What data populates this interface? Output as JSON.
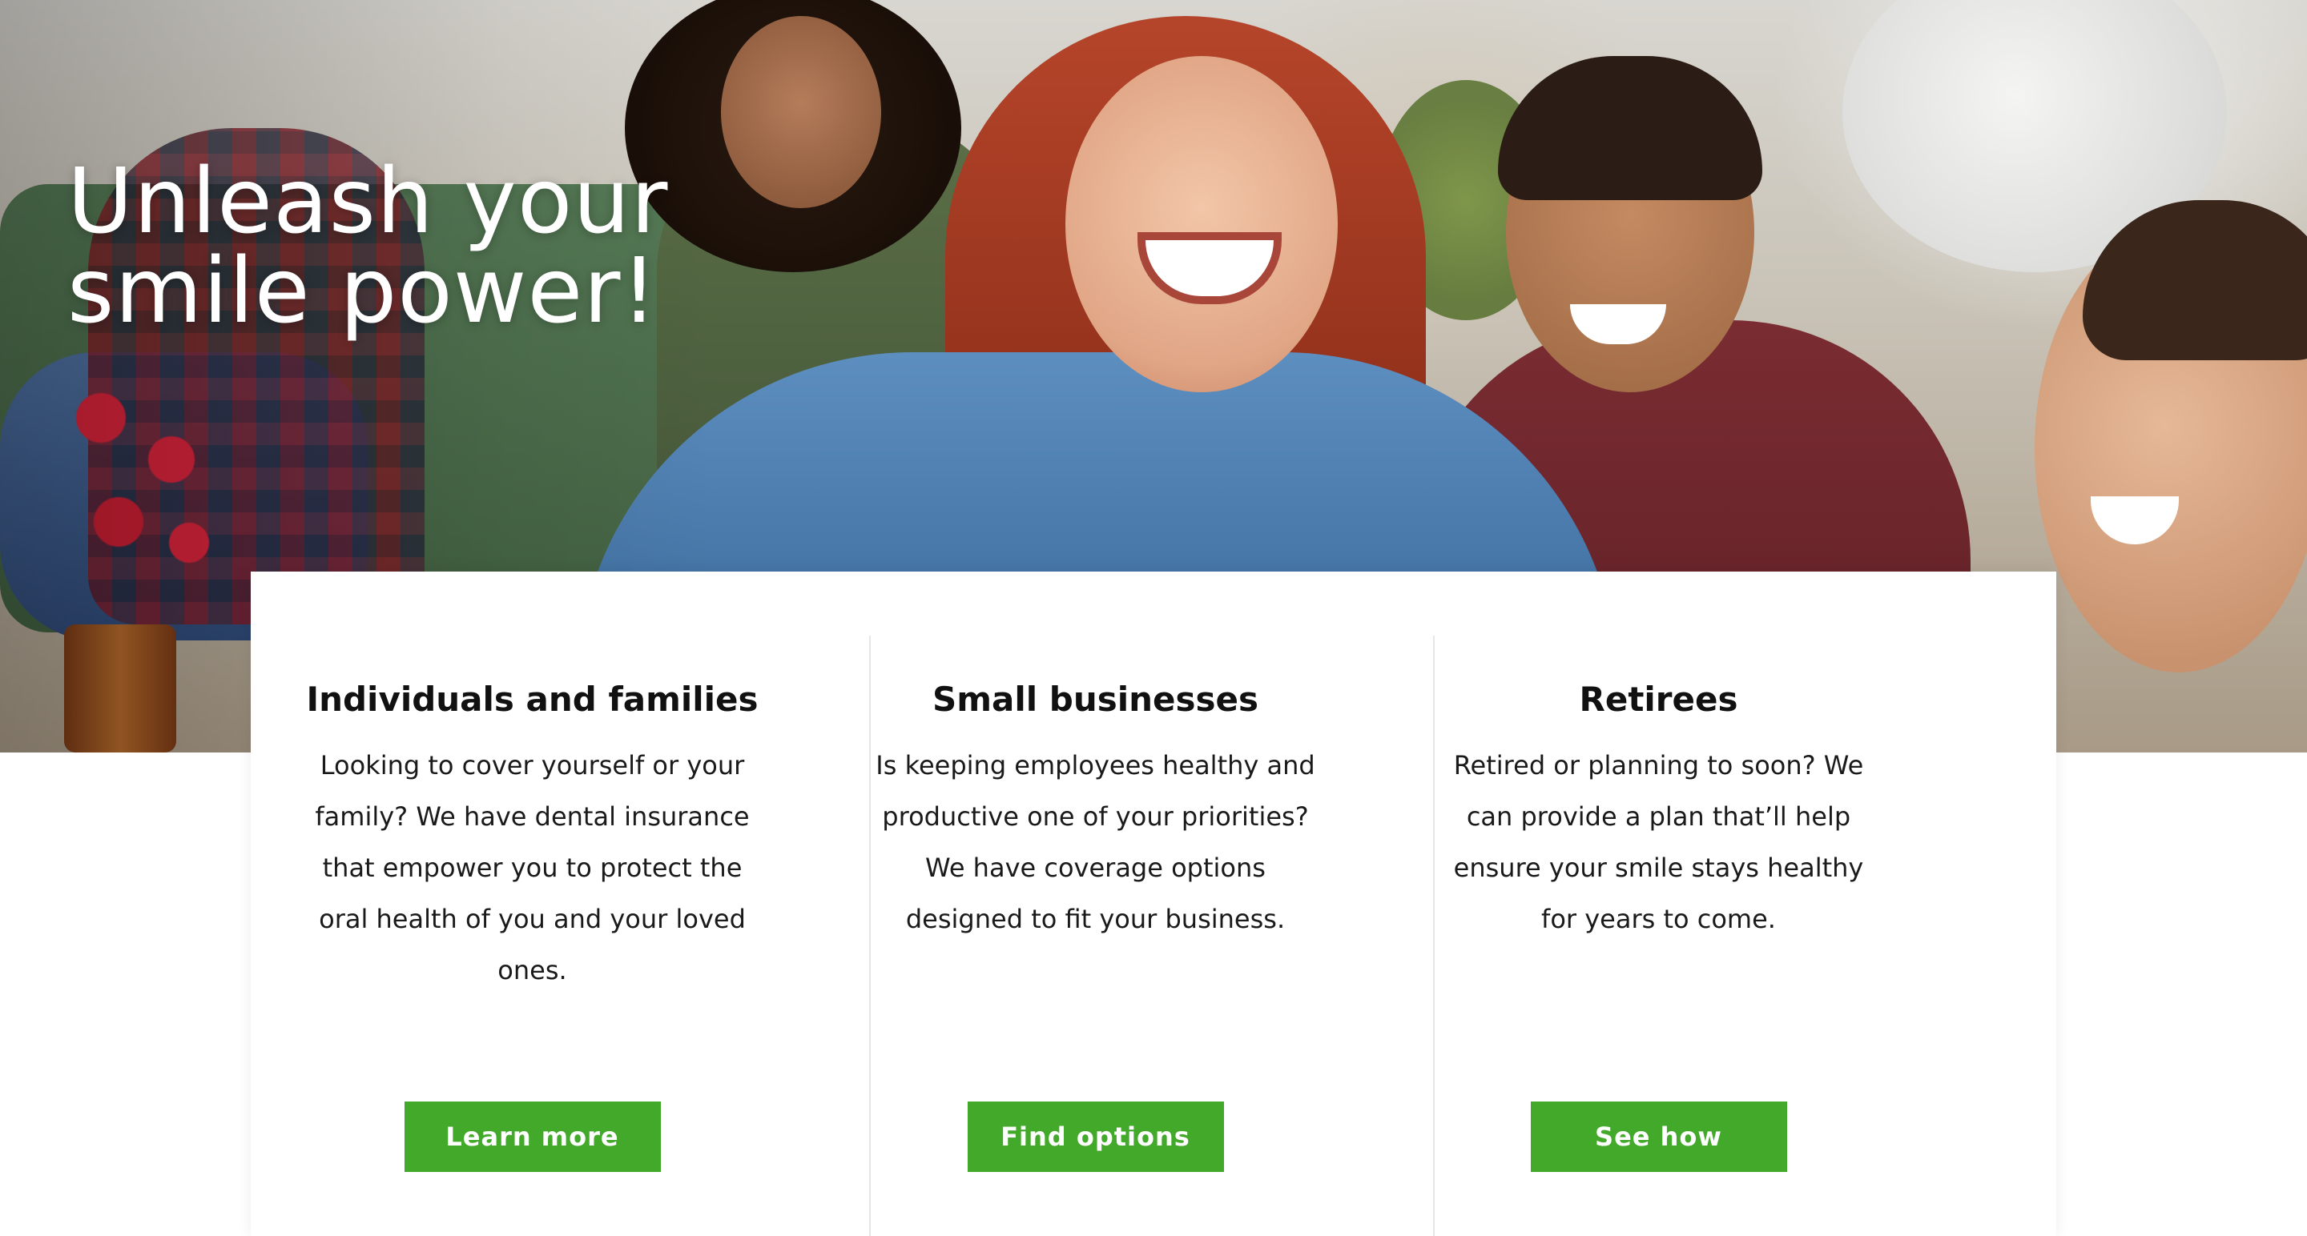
{
  "hero": {
    "title_line1": "Unleash your",
    "title_line2": "smile power!"
  },
  "colors": {
    "button_green": "#43a92b",
    "panel_bg": "#ffffff",
    "divider": "#e6e6e6",
    "hero_title": "#ffffff"
  },
  "cards": [
    {
      "title": "Individuals and families",
      "text": "Looking to cover yourself or your family? We have dental insurance that empower you to protect the oral health of you and your loved ones.",
      "button": "Learn more"
    },
    {
      "title": "Small businesses",
      "text": "Is keeping employees healthy and productive one of your priorities? We have coverage options designed to fit your business.",
      "button": "Find options"
    },
    {
      "title": "Retirees",
      "text": "Retired or planning to soon? We can provide a plan that’ll help ensure your smile stays healthy for years to come.",
      "button": "See how"
    }
  ]
}
